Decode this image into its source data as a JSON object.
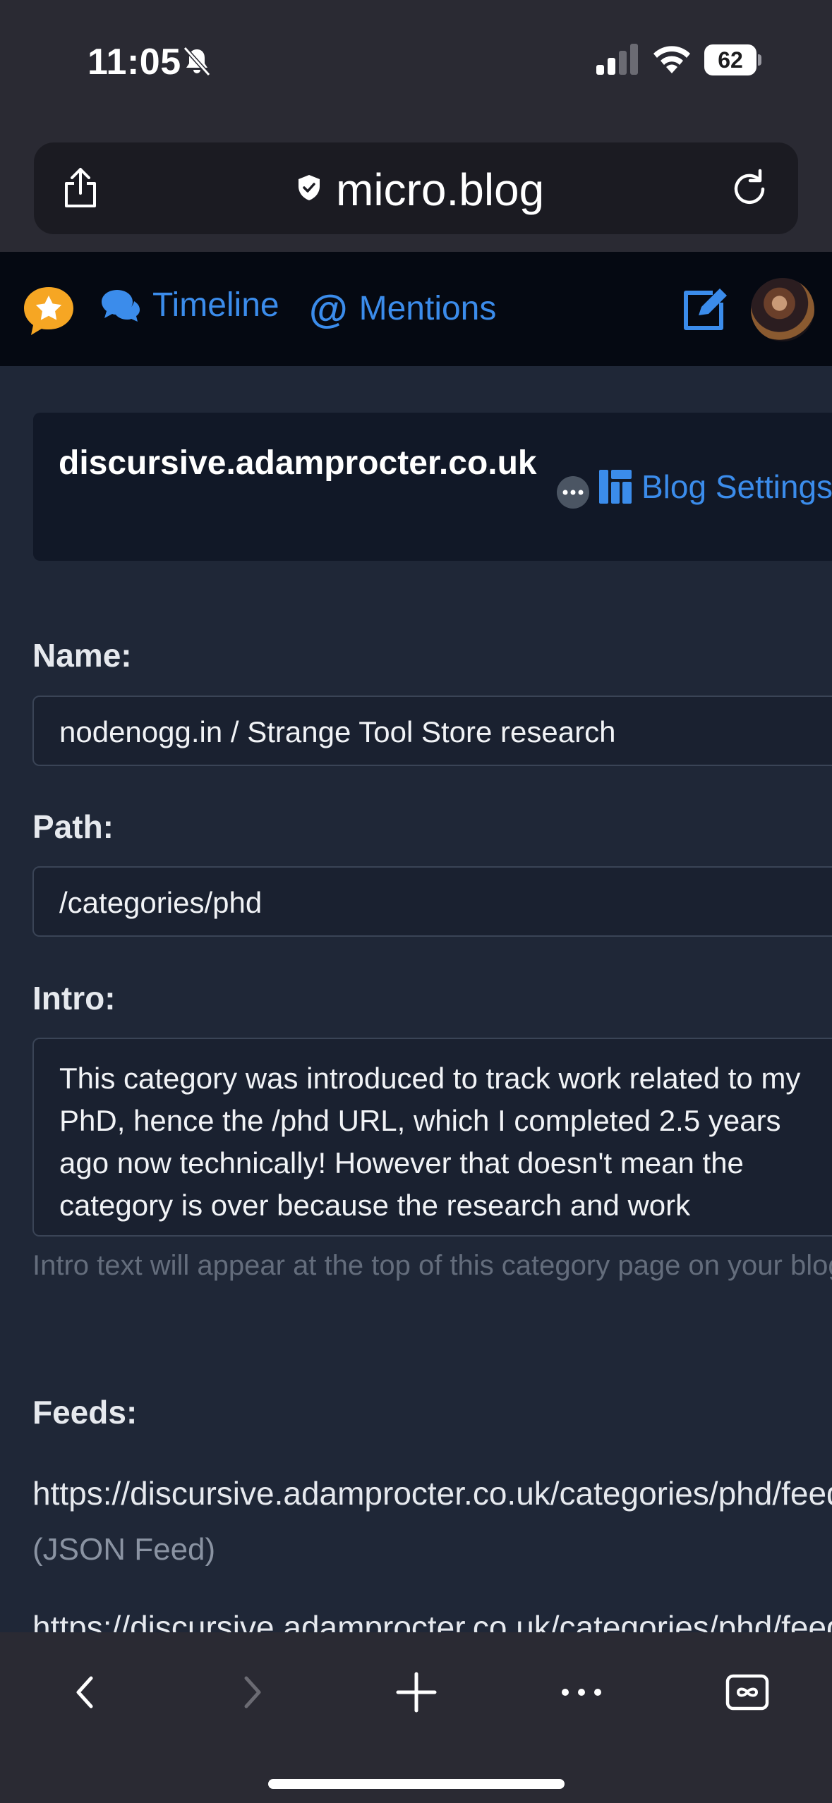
{
  "status_bar": {
    "time": "11:05",
    "battery_percent": "62",
    "signal_icon": "cellular-signal-icon",
    "wifi_icon": "wifi-icon",
    "mute_icon": "bell-slash-icon"
  },
  "browser": {
    "url": "micro.blog",
    "share_icon": "share-icon",
    "reload_icon": "reload-icon"
  },
  "nav": {
    "timeline_label": "Timeline",
    "mentions_label": "Mentions",
    "accent_color": "#3b8ceb"
  },
  "blog_header": {
    "name": "discursive.adamprocter.co.uk",
    "settings_label": "Blog Settings"
  },
  "form": {
    "name_label": "Name:",
    "name_value": "nodenogg.in / Strange Tool Store research",
    "path_label": "Path:",
    "path_value": "/categories/phd",
    "intro_label": "Intro:",
    "intro_value": "This category was introduced to track work related to my PhD, hence the /phd URL, which I completed 2.5 years ago now technically! However that doesn't mean the category is over because the research and work continues in fact, as the nodenogg.in and the Strange Tool Store research lives here too.",
    "intro_help": "Intro text will appear at the top of this category page on your blog.",
    "feeds_label": "Feeds:",
    "feeds": [
      {
        "url": "https://discursive.adamprocter.co.uk/categories/phd/feed.json",
        "kind": "(JSON Feed)"
      },
      {
        "url": "https://discursive.adamprocter.co.uk/categories/phd/feed.xml",
        "kind": ""
      }
    ]
  },
  "toolbar": {
    "back_icon": "chevron-left-icon",
    "forward_icon": "chevron-right-icon",
    "new_tab_icon": "plus-icon",
    "more_icon": "ellipsis-icon",
    "tabs_icon": "tabs-icon"
  }
}
